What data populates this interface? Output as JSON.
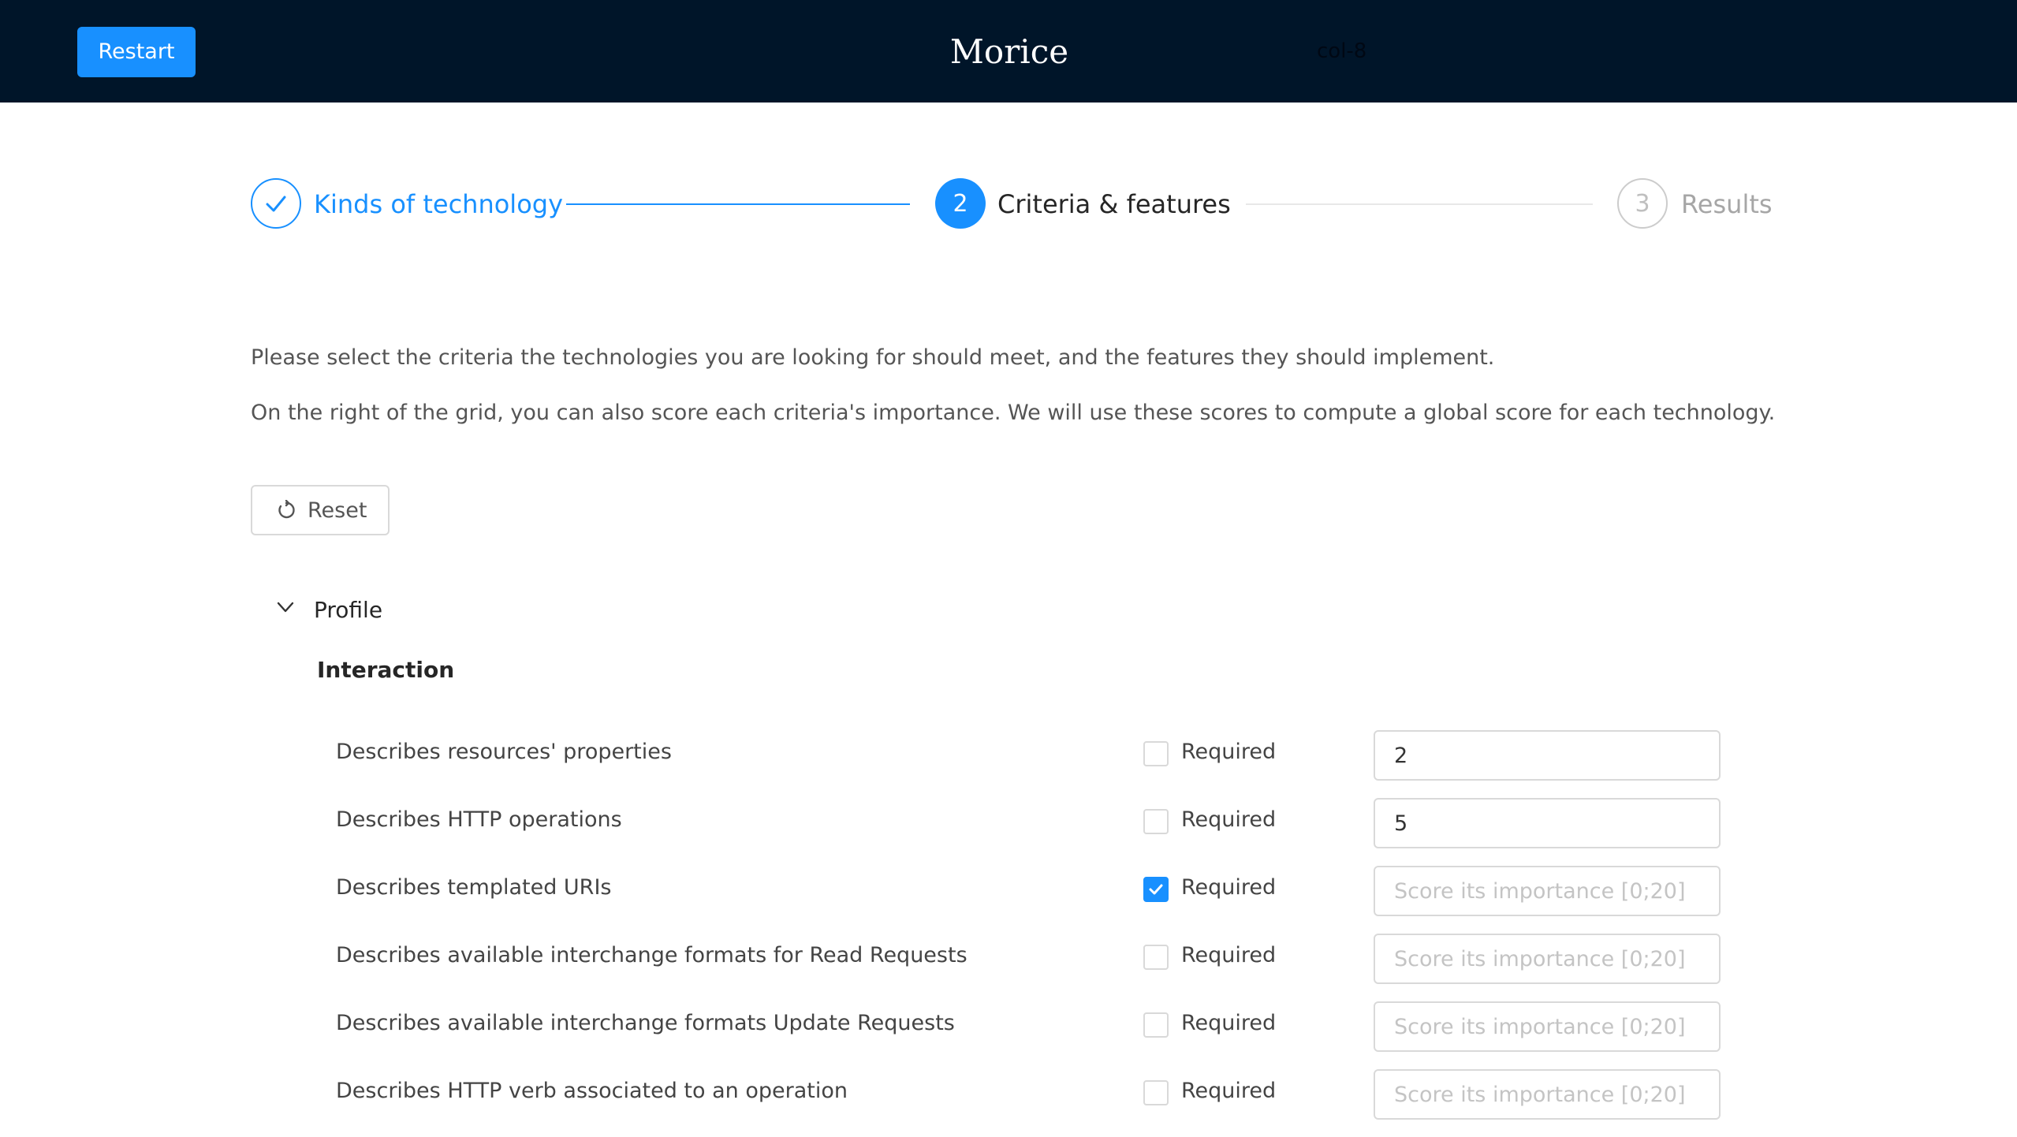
{
  "header": {
    "restart_label": "Restart",
    "app_title": "Morice",
    "col_hint": "col-8"
  },
  "steps": [
    {
      "label": "Kinds of technology",
      "status": "done",
      "icon": "check-icon"
    },
    {
      "number": "2",
      "label": "Criteria & features",
      "status": "active"
    },
    {
      "number": "3",
      "label": "Results",
      "status": "wait"
    }
  ],
  "intro": {
    "line1": "Please select the criteria the technologies you are looking for should meet, and the features they should implement.",
    "line2": "On the right of the grid, you can also score each criteria's importance. We will use these scores to compute a global score for each technology."
  },
  "reset_label": "Reset",
  "group": {
    "title": "Profile",
    "subgroup_title": "Interaction",
    "criteria": [
      {
        "label": "Describes resources' properties",
        "required_label": "Required",
        "required": false,
        "score": "2",
        "placeholder": "Score its importance [0;20]"
      },
      {
        "label": "Describes HTTP operations",
        "required_label": "Required",
        "required": false,
        "score": "5",
        "placeholder": "Score its importance [0;20]"
      },
      {
        "label": "Describes templated URIs",
        "required_label": "Required",
        "required": true,
        "score": "",
        "placeholder": "Score its importance [0;20]"
      },
      {
        "label": "Describes available interchange formats for Read Requests",
        "required_label": "Required",
        "required": false,
        "score": "",
        "placeholder": "Score its importance [0;20]"
      },
      {
        "label": "Describes available interchange formats Update Requests",
        "required_label": "Required",
        "required": false,
        "score": "",
        "placeholder": "Score its importance [0;20]"
      },
      {
        "label": "Describes HTTP verb associated to an operation",
        "required_label": "Required",
        "required": false,
        "score": "",
        "placeholder": "Score its importance [0;20]"
      }
    ]
  },
  "colors": {
    "header_bg": "#001529",
    "primary": "#1890ff",
    "border": "#d9d9d9"
  }
}
